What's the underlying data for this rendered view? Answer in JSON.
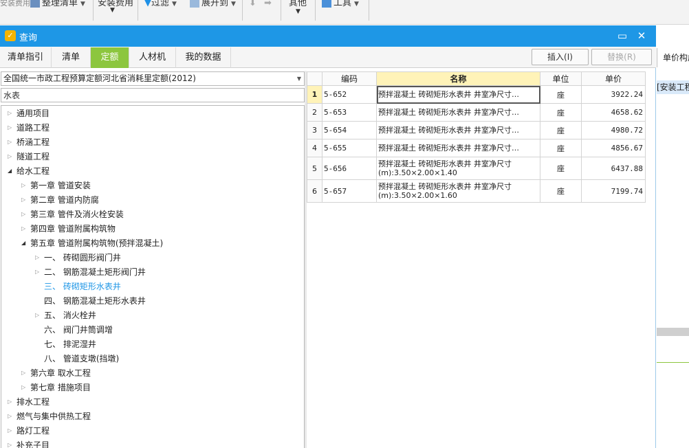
{
  "toolbar": {
    "items": [
      {
        "label": "安装费用"
      },
      {
        "label": "整理清单"
      },
      {
        "label": "安装费用"
      },
      {
        "label": "过滤"
      },
      {
        "label": "展开到"
      },
      {
        "label": "其他"
      },
      {
        "label": "工具"
      }
    ]
  },
  "dialog": {
    "title": "查询",
    "tabs": [
      {
        "label": "清单指引"
      },
      {
        "label": "清单"
      },
      {
        "label": "定额"
      },
      {
        "label": "人材机"
      },
      {
        "label": "我的数据"
      }
    ],
    "insert_button": "插入(I)",
    "replace_button": "替换(R)"
  },
  "left": {
    "quota_select": "全国统一市政工程预算定额河北省消耗里定额(2012)",
    "search_value": "水表",
    "tree": [
      {
        "label": "通用项目"
      },
      {
        "label": "道路工程"
      },
      {
        "label": "桥涵工程"
      },
      {
        "label": "隧道工程"
      },
      {
        "label": "给水工程"
      },
      {
        "label": "第一章 管道安装"
      },
      {
        "label": "第二章 管道内防腐"
      },
      {
        "label": "第三章 管件及消火栓安装"
      },
      {
        "label": "第四章 管道附属构筑物"
      },
      {
        "label": "第五章 管道附属构筑物(预拌混凝土)"
      },
      {
        "label": "一、 砖砌圆形阀门井"
      },
      {
        "label": "二、 钢筋混凝土矩形阀门井"
      },
      {
        "label": "三、 砖砌矩形水表井"
      },
      {
        "label": "四、 钢筋混凝土矩形水表井"
      },
      {
        "label": "五、 消火栓井"
      },
      {
        "label": "六、 阀门井筒调增"
      },
      {
        "label": "七、 排泥湿井"
      },
      {
        "label": "八、 管道支墩(挡墩)"
      },
      {
        "label": "第六章 取水工程"
      },
      {
        "label": "第七章 措施项目"
      },
      {
        "label": "排水工程"
      },
      {
        "label": "燃气与集中供热工程"
      },
      {
        "label": "路灯工程"
      },
      {
        "label": "补充子目"
      }
    ]
  },
  "grid": {
    "headers": {
      "code": "编码",
      "name": "名称",
      "unit": "单位",
      "price": "单价"
    },
    "rows": [
      {
        "no": "1",
        "code": "5-652",
        "name": "预拌混凝土 砖砌矩形水表井 井室净尺寸…",
        "name2": "",
        "unit": "座",
        "price": "3922.24"
      },
      {
        "no": "2",
        "code": "5-653",
        "name": "预拌混凝土 砖砌矩形水表井 井室净尺寸…",
        "name2": "",
        "unit": "座",
        "price": "4658.62"
      },
      {
        "no": "3",
        "code": "5-654",
        "name": "预拌混凝土 砖砌矩形水表井 井室净尺寸…",
        "name2": "",
        "unit": "座",
        "price": "4980.72"
      },
      {
        "no": "4",
        "code": "5-655",
        "name": "预拌混凝土 砖砌矩形水表井 井室净尺寸…",
        "name2": "",
        "unit": "座",
        "price": "4856.67"
      },
      {
        "no": "5",
        "code": "5-656",
        "name": "预拌混凝土 砖砌矩形水表井 井室净尺寸",
        "name2": "(m):3.50×2.00×1.40",
        "unit": "座",
        "price": "6437.88"
      },
      {
        "no": "6",
        "code": "5-657",
        "name": "预拌混凝土 砖砌矩形水表井 井室净尺寸",
        "name2": "(m):3.50×2.00×1.60",
        "unit": "座",
        "price": "7199.74"
      }
    ]
  },
  "right": {
    "tab_label": "单价构成",
    "row_text": "[安装工程"
  }
}
